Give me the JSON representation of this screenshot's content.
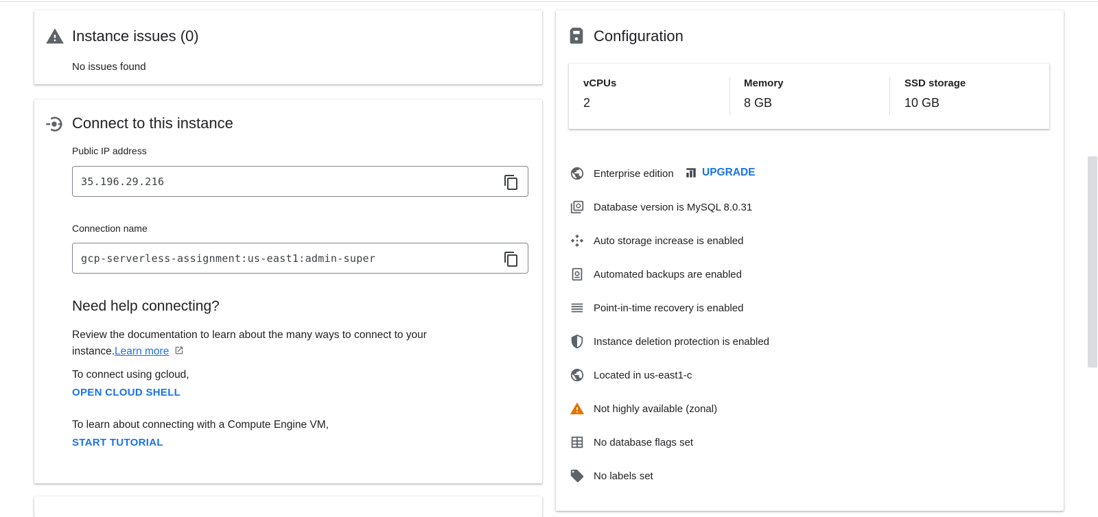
{
  "issues": {
    "title": "Instance issues (0)",
    "message": "No issues found"
  },
  "connect": {
    "title": "Connect to this instance",
    "ip_label": "Public IP address",
    "ip_value": "35.196.29.216",
    "conn_label": "Connection name",
    "conn_value": "gcp-serverless-assignment:us-east1:admin-super",
    "help_title": "Need help connecting?",
    "help_text_1": "Review the documentation to learn about the many ways to connect to your",
    "help_text_2": "instance.",
    "learn_more": "Learn more",
    "gcloud_text": "To connect using gcloud,",
    "open_shell": "OPEN CLOUD SHELL",
    "vm_text": "To learn about connecting with a Compute Engine VM,",
    "start_tutorial": "START TUTORIAL"
  },
  "config": {
    "title": "Configuration",
    "stats": [
      {
        "label": "vCPUs",
        "value": "2"
      },
      {
        "label": "Memory",
        "value": "8 GB"
      },
      {
        "label": "SSD storage",
        "value": "10 GB"
      }
    ],
    "upgrade_label": "UPGRADE",
    "rows": [
      {
        "icon": "globe-icon",
        "text": "Enterprise edition"
      },
      {
        "icon": "database-version-icon",
        "text": "Database version is MySQL 8.0.31"
      },
      {
        "icon": "auto-storage-icon",
        "text": "Auto storage increase is enabled"
      },
      {
        "icon": "backup-icon",
        "text": "Automated backups are enabled"
      },
      {
        "icon": "recovery-icon",
        "text": "Point-in-time recovery is enabled"
      },
      {
        "icon": "shield-icon",
        "text": "Instance deletion protection is enabled"
      },
      {
        "icon": "globe-icon",
        "text": "Located in us-east1-c"
      },
      {
        "icon": "warning-icon",
        "text": "Not highly available (zonal)"
      },
      {
        "icon": "table-icon",
        "text": "No database flags set"
      },
      {
        "icon": "label-icon",
        "text": "No labels set"
      }
    ]
  },
  "colors": {
    "accent": "#1a73e8",
    "warning": "#e37400",
    "icon": "#5f6368"
  }
}
